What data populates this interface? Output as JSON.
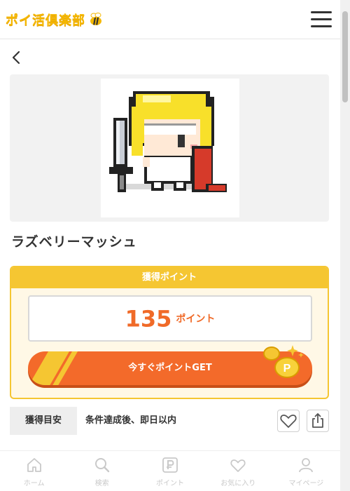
{
  "header": {
    "logo_text": "ポイ活倶楽部",
    "menu_icon": "hamburger-icon"
  },
  "nav": {
    "back_icon": "chevron-left-icon"
  },
  "offer": {
    "title": "ラズベリーマッシュ",
    "image": "pixel-knight-character"
  },
  "points": {
    "header_label": "獲得ポイント",
    "value": "135",
    "unit": "ポイント",
    "get_button_label": "今すぐポイントGET"
  },
  "info": {
    "label": "獲得目安",
    "text": "条件達成後、即日以内",
    "favorite_icon": "heart-icon",
    "share_icon": "share-icon"
  },
  "tabbar": {
    "items": [
      {
        "label": "ホーム",
        "icon": "home-icon"
      },
      {
        "label": "検索",
        "icon": "search-icon"
      },
      {
        "label": "ポイント",
        "icon": "point-icon"
      },
      {
        "label": "お気に入り",
        "icon": "heart-icon"
      },
      {
        "label": "マイページ",
        "icon": "user-icon"
      }
    ]
  },
  "colors": {
    "accent_yellow": "#f5c632",
    "accent_orange": "#f36a2a",
    "tab_inactive": "#c9c9c9"
  }
}
